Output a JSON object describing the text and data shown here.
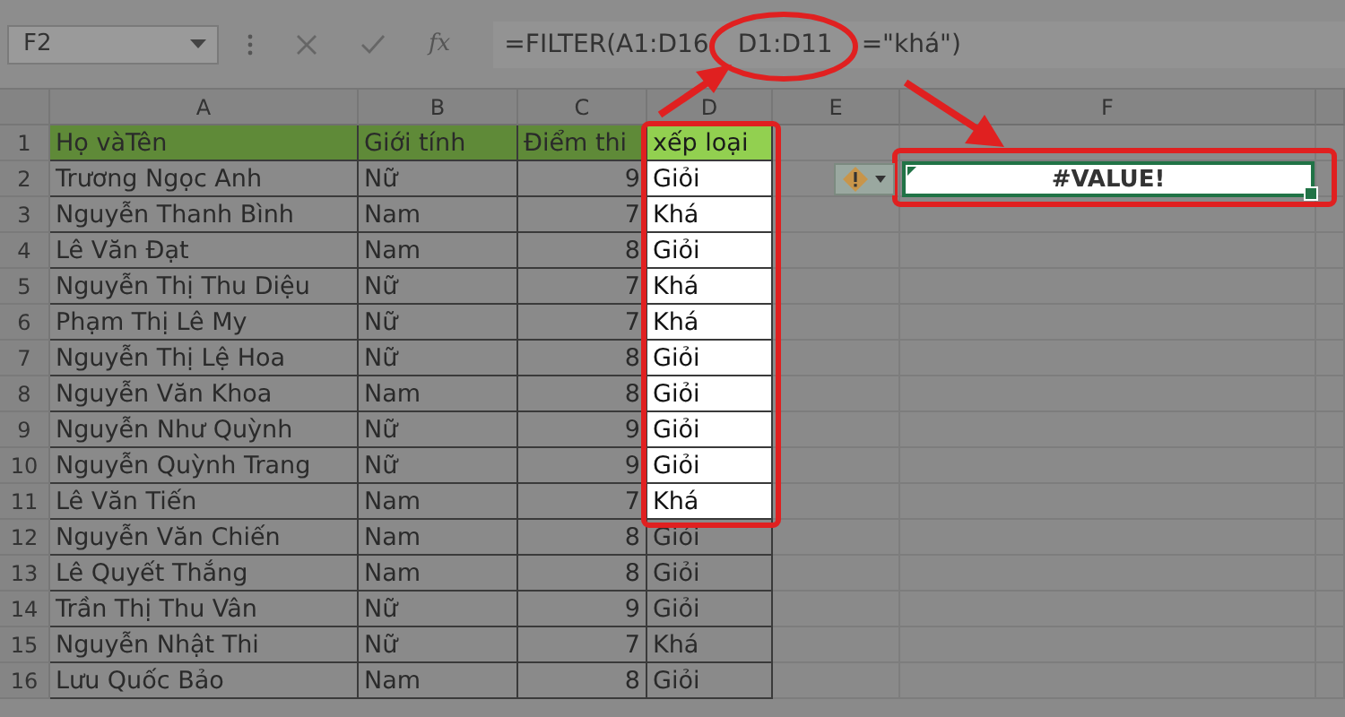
{
  "formula_bar": {
    "name_box": "F2",
    "function_label": "fx",
    "formula_before": "=FILTER(A1:D16",
    "formula_highlight": "D1:D11",
    "formula_after": "=\"khá\")"
  },
  "columns": [
    "A",
    "B",
    "C",
    "D",
    "E",
    "F"
  ],
  "header_row": {
    "number": "1",
    "cells": [
      "Họ vàTên",
      "Giới tính",
      "Điểm thi",
      "xếp loại"
    ],
    "highlighted": true
  },
  "rows": [
    {
      "number": "2",
      "name": "Trương Ngọc Anh",
      "gender": "Nữ",
      "score": "9",
      "rating": "Giỏi",
      "highlighted": true
    },
    {
      "number": "3",
      "name": "Nguyễn Thanh Bình",
      "gender": "Nam",
      "score": "7",
      "rating": "Khá",
      "highlighted": true
    },
    {
      "number": "4",
      "name": "Lê Văn Đạt",
      "gender": "Nam",
      "score": "8",
      "rating": "Giỏi",
      "highlighted": true
    },
    {
      "number": "5",
      "name": "Nguyễn Thị Thu Diệu",
      "gender": "Nữ",
      "score": "7",
      "rating": "Khá",
      "highlighted": true
    },
    {
      "number": "6",
      "name": "Phạm Thị Lê My",
      "gender": "Nữ",
      "score": "7",
      "rating": "Khá",
      "highlighted": true
    },
    {
      "number": "7",
      "name": "Nguyễn Thị Lệ Hoa",
      "gender": "Nữ",
      "score": "8",
      "rating": "Giỏi",
      "highlighted": true
    },
    {
      "number": "8",
      "name": "Nguyễn Văn Khoa",
      "gender": "Nam",
      "score": "8",
      "rating": "Giỏi",
      "highlighted": true
    },
    {
      "number": "9",
      "name": "Nguyễn Như Quỳnh",
      "gender": "Nữ",
      "score": "9",
      "rating": "Giỏi",
      "highlighted": true
    },
    {
      "number": "10",
      "name": "Nguyễn Quỳnh Trang",
      "gender": "Nữ",
      "score": "9",
      "rating": "Giỏi",
      "highlighted": true
    },
    {
      "number": "11",
      "name": "Lê Văn Tiến",
      "gender": "Nam",
      "score": "7",
      "rating": "Khá",
      "highlighted": true
    },
    {
      "number": "12",
      "name": "Nguyễn Văn Chiến",
      "gender": "Nam",
      "score": "8",
      "rating": "Giỏi",
      "highlighted": false
    },
    {
      "number": "13",
      "name": "Lê Quyết Thắng",
      "gender": "Nam",
      "score": "8",
      "rating": "Giỏi",
      "highlighted": false
    },
    {
      "number": "14",
      "name": "Trần Thị Thu Vân",
      "gender": "Nữ",
      "score": "9",
      "rating": "Giỏi",
      "highlighted": false
    },
    {
      "number": "15",
      "name": "Nguyễn Nhật Thi",
      "gender": "Nữ",
      "score": "7",
      "rating": "Khá",
      "highlighted": false
    },
    {
      "number": "16",
      "name": "Lưu Quốc Bảo",
      "gender": "Nam",
      "score": "8",
      "rating": "Giỏi",
      "highlighted": false
    }
  ],
  "error_cell": {
    "text": "#VALUE!",
    "selected": true
  }
}
